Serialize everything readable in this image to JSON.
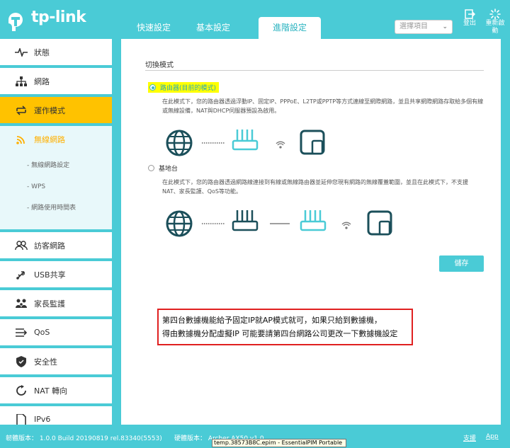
{
  "header": {
    "logo_text": "tp-link",
    "tabs": [
      {
        "label": "快速設定"
      },
      {
        "label": "基本設定"
      },
      {
        "label": "進階設定"
      }
    ],
    "select_placeholder": "選擇項目",
    "logout_label": "登出",
    "reboot_label": "重新啟動"
  },
  "sidebar": {
    "items": [
      {
        "label": "狀態",
        "icon": "pulse-icon"
      },
      {
        "label": "網路",
        "icon": "network-icon"
      },
      {
        "label": "運作模式",
        "icon": "swap-icon"
      },
      {
        "label": "無線網路",
        "icon": "wifi-icon"
      },
      {
        "label": "訪客網路",
        "icon": "guests-icon"
      },
      {
        "label": "USB共享",
        "icon": "usb-icon"
      },
      {
        "label": "家長監護",
        "icon": "family-icon"
      },
      {
        "label": "QoS",
        "icon": "qos-icon"
      },
      {
        "label": "安全性",
        "icon": "shield-icon"
      },
      {
        "label": "NAT 轉向",
        "icon": "nat-icon"
      },
      {
        "label": "IPv6",
        "icon": "ipv6-icon"
      }
    ],
    "wireless_sub": [
      "- 無線網路設定",
      "- WPS",
      "- 網路使用時間表"
    ]
  },
  "main": {
    "section_title": "切換模式",
    "router_option": {
      "label": "路由器(目前的模式)",
      "desc": "在此模式下，您的路由器透過浮動IP、固定IP、PPPoE、L2TP或PPTP等方式連線至網際網路，並且共享網際網路存取給多個有線或無線設備，NAT與DHCP伺服器預設為啟用。"
    },
    "ap_option": {
      "label": "基地台",
      "desc": "在此模式下，您的路由器透過網路線連接到有線或無線路由器並延伸您現有網路的無線覆蓋範圍，並且在此模式下，不支援NAT、家長監護、QoS等功能。"
    },
    "save_label": "儲存"
  },
  "annotation": {
    "line1": "第四台數據機能給予固定IP就AP模式就可，如果只給到數據機，",
    "line2": "得由數據機分配虛擬IP 可能要請第四台網路公司更改一下數據機設定"
  },
  "footer": {
    "firmware": "韌體版本：  1.0.0 Build 20190819 rel.83340(5553)",
    "hardware": "硬體版本：  Archer AX50 v1.0",
    "support": "支援",
    "app": "App"
  },
  "tooltip": "temp.38573B8C.epim - EssentialPIM Portable",
  "colors": {
    "accent": "#4acbd6",
    "active_item": "#ffc200",
    "annotation_border": "#e02020"
  }
}
